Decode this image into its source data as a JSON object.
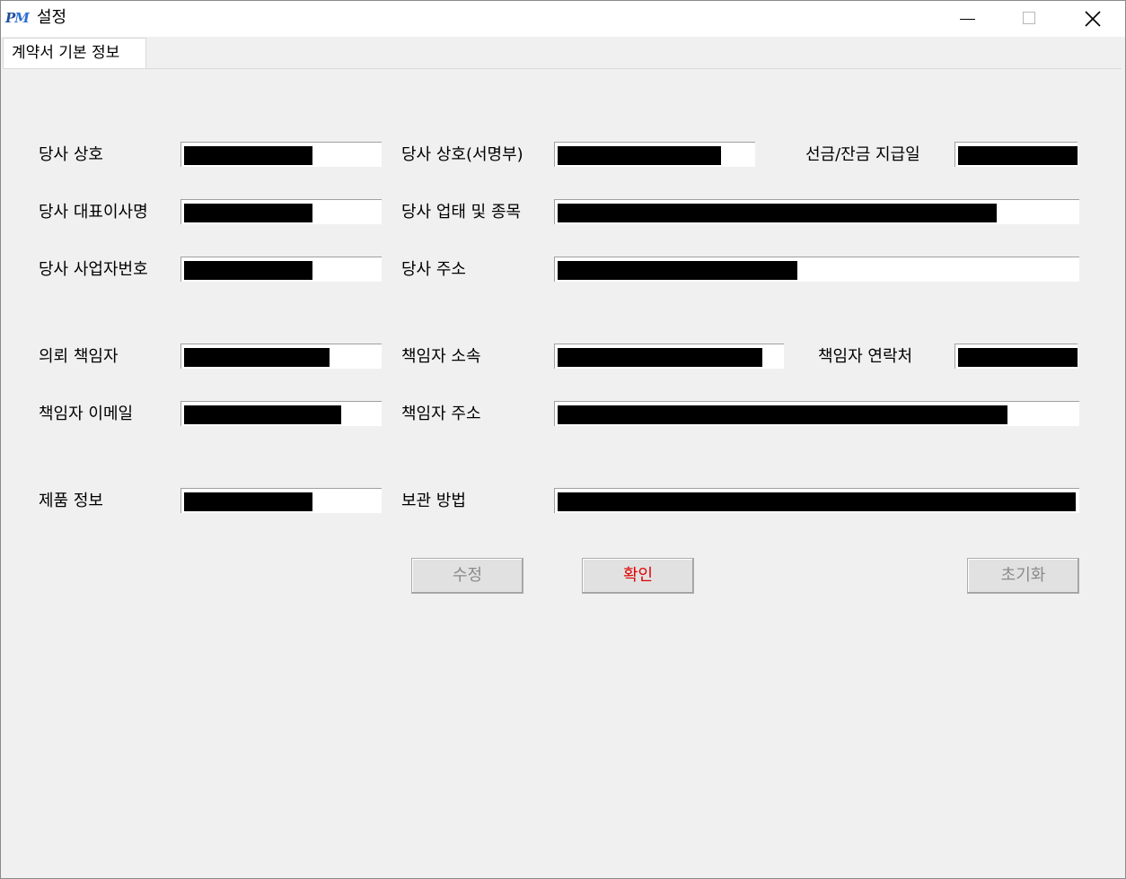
{
  "window": {
    "title": "설정",
    "logo_text": "PM",
    "controls": {
      "minimize": "minimize",
      "maximize": "maximize",
      "close": "close"
    }
  },
  "tabs": [
    {
      "label": "계약서 기본 정보",
      "active": true
    }
  ],
  "form": {
    "company_name_label": "당사 상호",
    "company_name_signature_label": "당사 상호(서명부)",
    "payment_date_label": "선금/잔금 지급일",
    "company_ceo_label": "당사 대표이사명",
    "business_type_label": "당사 업태 및 종목",
    "business_number_label": "당사 사업자번호",
    "company_address_label": "당사 주소",
    "contact_person_label": "의뢰 책임자",
    "person_affiliation_label": "책임자 소속",
    "person_phone_label": "책임자 연락처",
    "person_email_label": "책임자 이메일",
    "person_address_label": "책임자 주소",
    "product_info_label": "제품 정보",
    "storage_method_label": "보관 방법"
  },
  "buttons": {
    "edit": "수정",
    "confirm": "확인",
    "reset": "초기화"
  },
  "colors": {
    "confirm_text": "#e00000",
    "disabled_text": "#8a8a8a",
    "logo": "#1f4e9a"
  }
}
